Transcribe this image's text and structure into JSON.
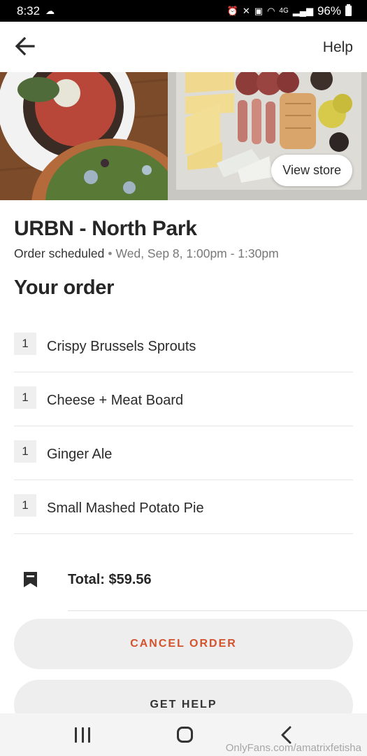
{
  "status_bar": {
    "time": "8:32",
    "battery": "96%",
    "network": "4G"
  },
  "header": {
    "back_icon": "arrow-left-icon",
    "help_label": "Help"
  },
  "hero": {
    "view_store_label": "View store"
  },
  "store": {
    "name": "URBN - North Park",
    "status": "Order scheduled",
    "separator": "•",
    "time": "Wed, Sep 8, 1:00pm - 1:30pm"
  },
  "order": {
    "heading": "Your order",
    "items": [
      {
        "qty": "1",
        "name": "Crispy Brussels Sprouts"
      },
      {
        "qty": "1",
        "name": "Cheese + Meat Board"
      },
      {
        "qty": "1",
        "name": "Ginger Ale"
      },
      {
        "qty": "1",
        "name": "Small Mashed Potato Pie"
      }
    ],
    "total": "Total: $59.56",
    "total_icon": "receipt-icon"
  },
  "actions": {
    "cancel_label": "CANCEL ORDER",
    "help_label": "GET HELP"
  },
  "colors": {
    "cancel_accent": "#d3532e",
    "button_bg": "#eeeeee"
  },
  "watermark": "OnlyFans.com/amatrixfetisha"
}
